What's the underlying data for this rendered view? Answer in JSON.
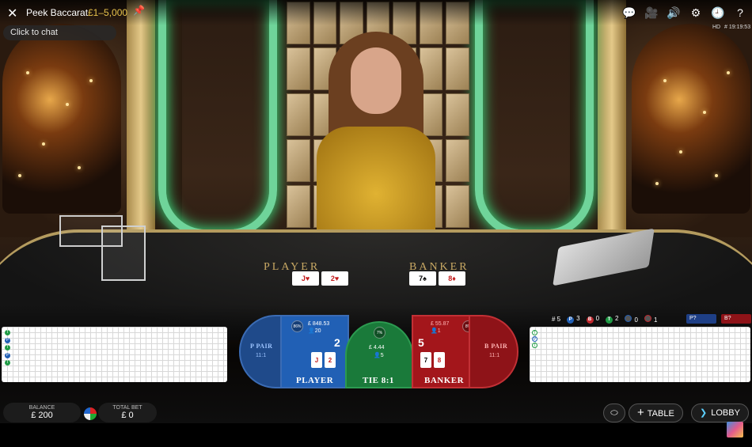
{
  "header": {
    "close_icon": "close-icon",
    "game_title": "Peek Baccarat",
    "limits": "£1–5,000",
    "pin_icon": "pin-icon",
    "chat_placeholder": "Click to chat",
    "quality": "HD",
    "table_id": "# 19:19:53",
    "icons": [
      "chat-bubbles-icon",
      "video-camera-icon",
      "volume-icon",
      "settings-icon",
      "history-icon",
      "help-icon"
    ]
  },
  "table": {
    "player_label": "PLAYER",
    "banker_label": "BANKER",
    "player_cards": [
      {
        "rank": "J",
        "suit": "♥",
        "red": true
      },
      {
        "rank": "2",
        "suit": "♥",
        "red": true
      }
    ],
    "banker_cards": [
      {
        "rank": "7",
        "suit": "♠",
        "red": false
      },
      {
        "rank": "8",
        "suit": "♦",
        "red": true
      }
    ]
  },
  "stats": {
    "round": "5",
    "player_wins": "3",
    "banker_wins": "0",
    "ties": "2",
    "player_pair": "0",
    "banker_pair": "1",
    "predict_player": "P?",
    "predict_banker": "B?",
    "colors": {
      "player": "#2160b5",
      "banker": "#c0272d",
      "tie": "#1f9a45"
    }
  },
  "bet_spots": {
    "p_pair": {
      "label": "P PAIR",
      "odds": "11:1"
    },
    "player": {
      "label": "PLAYER",
      "score": "2",
      "percent": "86%",
      "amount": "£ 848.53",
      "players": "20"
    },
    "tie": {
      "label": "TIE 8:1",
      "percent": "7%",
      "amount": "£ 4.44",
      "players": "5"
    },
    "banker": {
      "label": "BANKER",
      "score": "5",
      "percent": "8%",
      "amount": "£ 55.87",
      "players": "1"
    },
    "b_pair": {
      "label": "B PAIR",
      "odds": "11:1"
    },
    "player_cards": [
      {
        "rank": "J",
        "red": true
      },
      {
        "rank": "2",
        "red": true
      }
    ],
    "banker_cards": [
      {
        "rank": "7",
        "red": false
      },
      {
        "rank": "8",
        "red": true
      }
    ]
  },
  "footer": {
    "balance_label": "BALANCE",
    "balance_value": "£ 200",
    "total_bet_label": "TOTAL BET",
    "total_bet_value": "£ 0",
    "table_button": "TABLE",
    "lobby_button": "LOBBY",
    "chips_icon": "chip-stack-icon",
    "toggle_icon": "chip-toggle-icon",
    "lobby_icon": "chevron-right-icon",
    "table_icon": "plus-icon"
  },
  "roadmap_left_markers": [
    "T",
    "P",
    "T",
    "P",
    "T"
  ],
  "roadmap_right_markers": [
    "T",
    "P",
    "T"
  ]
}
